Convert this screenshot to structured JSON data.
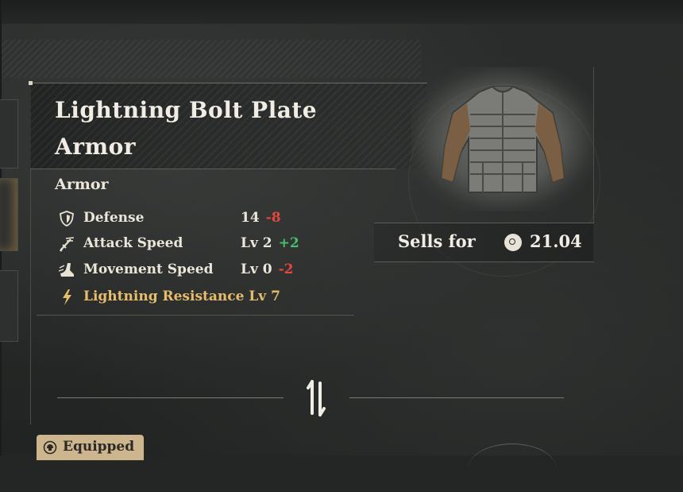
{
  "item": {
    "name": "Lightning Bolt Plate Armor",
    "category": "Armor",
    "stats": [
      {
        "icon": "shield-icon",
        "name": "Defense",
        "value": "14",
        "delta": "-8",
        "delta_type": "negative"
      },
      {
        "icon": "sword-icon",
        "name": "Attack Speed",
        "value": "Lv 2",
        "delta": "+2",
        "delta_type": "positive"
      },
      {
        "icon": "boot-icon",
        "name": "Movement Speed",
        "value": "Lv 0",
        "delta": "-2",
        "delta_type": "negative"
      }
    ],
    "bonus": {
      "icon": "lightning-icon",
      "text": "Lightning Resistance Lv 7"
    },
    "sell": {
      "label": "Sells for",
      "icon": "coin-icon",
      "price": "21.04"
    }
  },
  "equipped_badge": {
    "icon": "equipped-helmet-icon",
    "label": "Equipped"
  },
  "swap_icon": "swap-arrows-icon",
  "colors": {
    "negative": "#e4473d",
    "positive": "#45c06b",
    "bonus": "#e7bd6c",
    "badge": "#cdb58d"
  }
}
